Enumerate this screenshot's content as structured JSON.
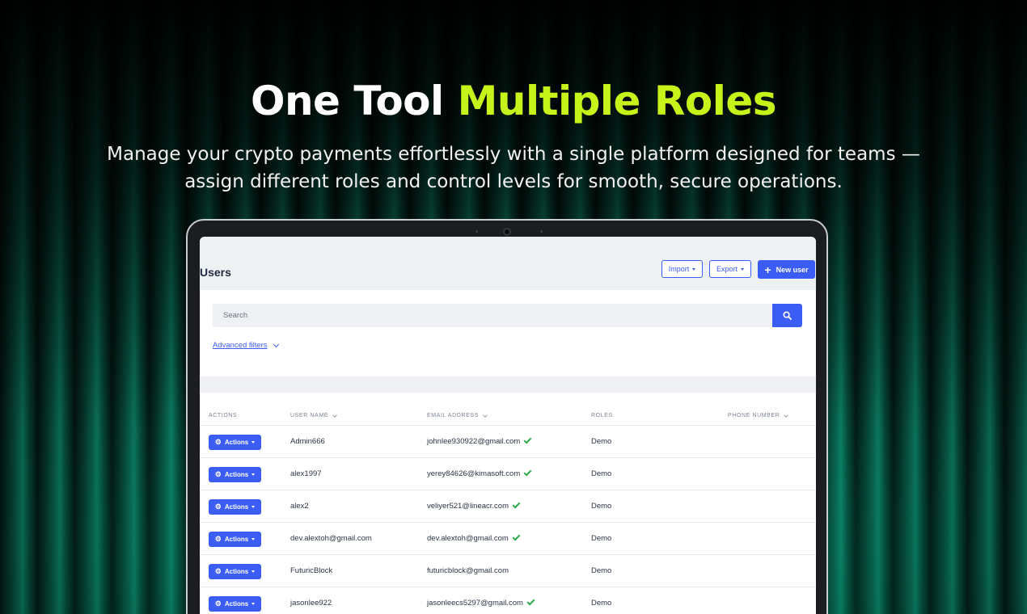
{
  "hero": {
    "title_white": "One Tool",
    "title_accent": "Multiple Roles",
    "subtitle": "Manage your crypto payments effortlessly with a single platform designed for teams — assign different roles and control levels for smooth, secure operations."
  },
  "colors": {
    "accent": "#c6f31a",
    "primary": "#3b5cf5",
    "verified": "#2fa84f"
  },
  "app": {
    "page_title": "Users",
    "toolbar": {
      "import_label": "Import",
      "export_label": "Export",
      "new_user_label": "New user"
    },
    "search": {
      "placeholder": "Search",
      "icon": "search-icon"
    },
    "advanced_filters_label": "Advanced filters",
    "table": {
      "columns": [
        "ACTIONS",
        "USER NAME",
        "EMAIL ADDRESS",
        "ROLES",
        "PHONE NUMBER"
      ],
      "action_label": "Actions",
      "rows": [
        {
          "username": "Admin666",
          "email": "johnlee930922@gmail.com",
          "verified": true,
          "role": "Demo",
          "phone": ""
        },
        {
          "username": "alex1997",
          "email": "yerey84626@kimasoft.com",
          "verified": true,
          "role": "Demo",
          "phone": ""
        },
        {
          "username": "alex2",
          "email": "veliyer521@lineacr.com",
          "verified": true,
          "role": "Demo",
          "phone": ""
        },
        {
          "username": "dev.alextoh@gmail.com",
          "email": "dev.alextoh@gmail.com",
          "verified": true,
          "role": "Demo",
          "phone": ""
        },
        {
          "username": "FuturicBlock",
          "email": "futuricblock@gmail.com",
          "verified": false,
          "role": "Demo",
          "phone": ""
        },
        {
          "username": "jasonlee922",
          "email": "jasonleecs5297@gmail.com",
          "verified": true,
          "role": "Demo",
          "phone": ""
        }
      ]
    }
  }
}
